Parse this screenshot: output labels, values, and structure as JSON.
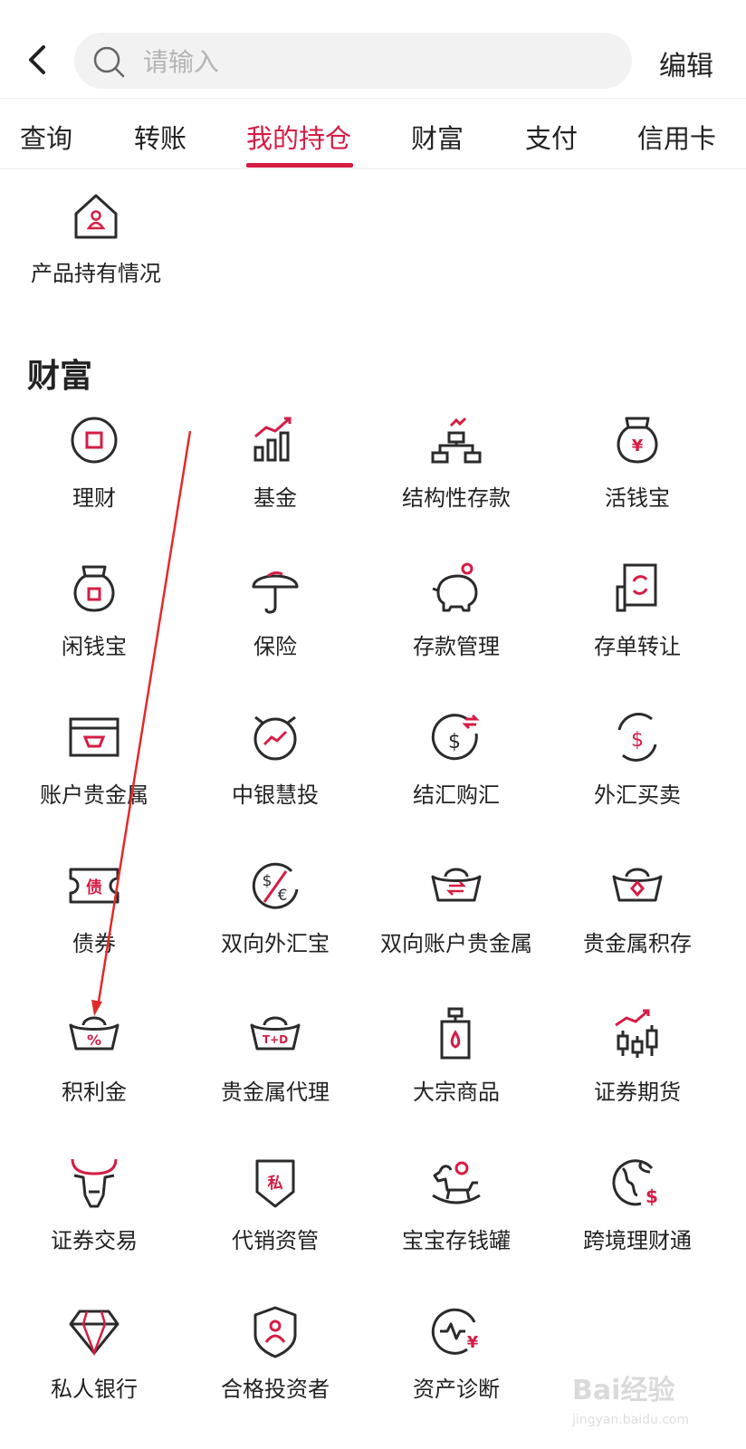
{
  "header": {
    "search_placeholder": "请输入",
    "edit_label": "编辑"
  },
  "tabs": [
    {
      "label": "查询"
    },
    {
      "label": "转账"
    },
    {
      "label": "我的持仓"
    },
    {
      "label": "财富"
    },
    {
      "label": "支付"
    },
    {
      "label": "信用卡"
    }
  ],
  "active_tab": "我的持仓",
  "holdings": {
    "label": "产品持有情况"
  },
  "wealth": {
    "title": "财富",
    "items": [
      {
        "label": "理财",
        "icon": "circle-square-icon"
      },
      {
        "label": "基金",
        "icon": "bar-chart-up-icon"
      },
      {
        "label": "结构性存款",
        "icon": "structure-icon"
      },
      {
        "label": "活钱宝",
        "icon": "money-bag-yen-icon"
      },
      {
        "label": "闲钱宝",
        "icon": "money-bag-icon"
      },
      {
        "label": "保险",
        "icon": "umbrella-icon"
      },
      {
        "label": "存款管理",
        "icon": "piggy-bank-icon"
      },
      {
        "label": "存单转让",
        "icon": "certificate-transfer-icon"
      },
      {
        "label": "账户贵金属",
        "icon": "gold-box-icon"
      },
      {
        "label": "中银慧投",
        "icon": "alarm-chart-icon"
      },
      {
        "label": "结汇购汇",
        "icon": "dollar-exchange-icon"
      },
      {
        "label": "外汇买卖",
        "icon": "dollar-cycle-icon"
      },
      {
        "label": "债券",
        "icon": "bond-ticket-icon"
      },
      {
        "label": "双向外汇宝",
        "icon": "dollar-euro-icon"
      },
      {
        "label": "双向账户贵金属",
        "icon": "ingot-exchange-icon"
      },
      {
        "label": "贵金属积存",
        "icon": "ingot-diamond-icon"
      },
      {
        "label": "积利金",
        "icon": "ingot-percent-icon"
      },
      {
        "label": "贵金属代理",
        "icon": "ingot-td-icon"
      },
      {
        "label": "大宗商品",
        "icon": "oil-can-icon"
      },
      {
        "label": "证券期货",
        "icon": "candlestick-icon"
      },
      {
        "label": "证券交易",
        "icon": "bull-icon"
      },
      {
        "label": "代销资管",
        "icon": "private-shield-icon"
      },
      {
        "label": "宝宝存钱罐",
        "icon": "rocking-horse-icon"
      },
      {
        "label": "跨境理财通",
        "icon": "globe-dollar-icon"
      },
      {
        "label": "私人银行",
        "icon": "diamond-icon"
      },
      {
        "label": "合格投资者",
        "icon": "shield-user-icon"
      },
      {
        "label": "资产诊断",
        "icon": "pulse-yen-icon"
      }
    ]
  },
  "glyphs": {
    "yen": "¥",
    "dollar": "$",
    "euro": "€",
    "percent": "%",
    "td": "T+D",
    "debt": "债",
    "private": "私"
  },
  "watermark": {
    "text": "Bai经验",
    "url": "jingyan.baidu.com"
  },
  "colors": {
    "accent": "#d51d44",
    "icon_stroke": "#2b2b2b",
    "arrow": "#e32a2a"
  }
}
